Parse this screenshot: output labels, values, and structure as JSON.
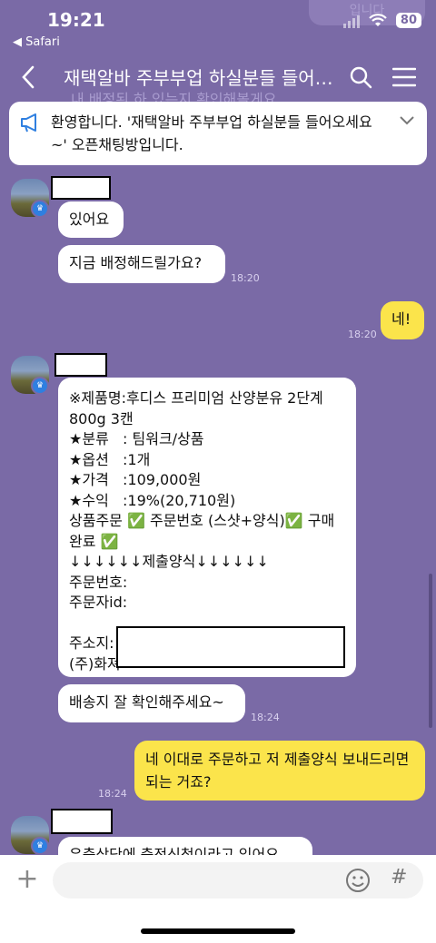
{
  "status": {
    "time": "19:21",
    "back_app": "◀ Safari",
    "battery": "80",
    "faded_top": "입니다"
  },
  "header": {
    "title": "재택알바 주부부업 하실분들 들어…",
    "faded_behind": "내 배정된 하 있는지 확인해볼게요"
  },
  "notice": {
    "text": "환영합니다. '재택알바 주부부업 하실분들 들어오세요~' 오픈채팅방입니다."
  },
  "messages": [
    {
      "text": "있어요"
    },
    {
      "text": "지금 배정해드릴가요?",
      "time": "18:20"
    },
    {
      "text": "네!",
      "time": "18:20"
    },
    {
      "text": "※제품명:후디스 프리미엄 산양분유 2단계\n800g 3캔\n★분류   : 팀워크/상품\n★옵션   :1개\n★가격   :109,000원\n★수익   :19%(20,710원)\n상품주문 ✅ 주문번호 (스샷+양식)✅ 구매완료 ✅\n↓↓↓↓↓↓제출양식↓↓↓↓↓↓\n주문번호:\n주문자id:\n\n주소지:\n(주)화져"
    },
    {
      "text": "배송지 잘 확인해주세요~",
      "time": "18:24"
    },
    {
      "text": "네 이대로 주문하고 저 제출양식 보내드리면 되는 거죠?",
      "time": "18:24"
    },
    {
      "text": "우측상단에 충전신청이라고 있어요"
    }
  ],
  "input": {
    "plus": "+",
    "hash": "#"
  }
}
